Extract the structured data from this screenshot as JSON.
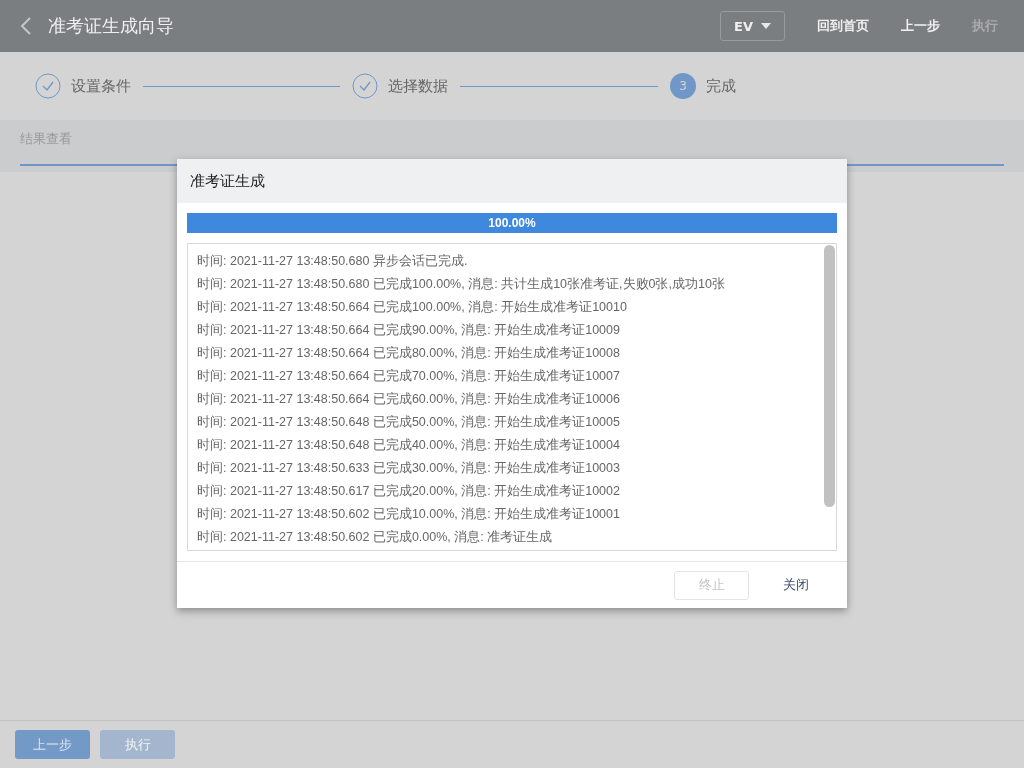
{
  "header": {
    "title": "准考证生成向导",
    "lang_menu": "EV",
    "buttons": [
      {
        "label": "回到首页",
        "disabled": false
      },
      {
        "label": "上一步",
        "disabled": false
      },
      {
        "label": "执行",
        "disabled": true
      }
    ]
  },
  "steps": [
    {
      "label": "设置条件",
      "done": true
    },
    {
      "label": "选择数据",
      "done": true
    },
    {
      "label": "完成",
      "done": false,
      "number": "3"
    }
  ],
  "tabs": [
    {
      "label": "结果查看",
      "selected": true
    }
  ],
  "dialog": {
    "title": "准考证生成",
    "progress": {
      "level": 1,
      "reading": "100.00%"
    },
    "log": [
      "时间: 2021-11-27 13:48:50.680 异步会话已完成.",
      "时间: 2021-11-27 13:48:50.680 已完成100.00%, 消息: 共计生成10张准考证,失败0张,成功10张",
      "时间: 2021-11-27 13:48:50.664 已完成100.00%, 消息: 开始生成准考证10010",
      "时间: 2021-11-27 13:48:50.664 已完成90.00%, 消息: 开始生成准考证10009",
      "时间: 2021-11-27 13:48:50.664 已完成80.00%, 消息: 开始生成准考证10008",
      "时间: 2021-11-27 13:48:50.664 已完成70.00%, 消息: 开始生成准考证10007",
      "时间: 2021-11-27 13:48:50.664 已完成60.00%, 消息: 开始生成准考证10006",
      "时间: 2021-11-27 13:48:50.648 已完成50.00%, 消息: 开始生成准考证10005",
      "时间: 2021-11-27 13:48:50.648 已完成40.00%, 消息: 开始生成准考证10004",
      "时间: 2021-11-27 13:48:50.633 已完成30.00%, 消息: 开始生成准考证10003",
      "时间: 2021-11-27 13:48:50.617 已完成20.00%, 消息: 开始生成准考证10002",
      "时间: 2021-11-27 13:48:50.602 已完成10.00%, 消息: 开始生成准考证10001",
      "时间: 2021-11-27 13:48:50.602 已完成0.00%, 消息: 准考证生成"
    ],
    "buttons": [
      {
        "label": "终止",
        "disabled": true
      },
      {
        "label": "关闭",
        "disabled": false
      }
    ]
  },
  "footer": {
    "buttons": [
      {
        "label": "上一步",
        "disabled": false
      },
      {
        "label": "执行",
        "disabled": true
      }
    ]
  }
}
